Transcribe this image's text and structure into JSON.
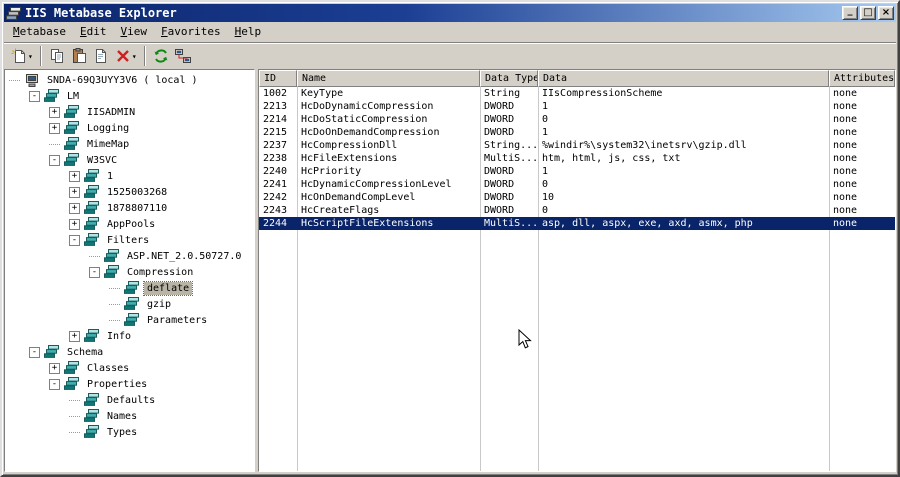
{
  "window": {
    "title": "IIS Metabase Explorer",
    "controls": {
      "minimize": "_",
      "maximize": "□",
      "close": "×"
    }
  },
  "menubar": {
    "items": [
      {
        "label": "Metabase"
      },
      {
        "label": "Edit"
      },
      {
        "label": "View"
      },
      {
        "label": "Favorites"
      },
      {
        "label": "Help"
      }
    ]
  },
  "toolbar": {
    "buttons": [
      {
        "name": "new-record-button",
        "icon": "new",
        "dropdown": true
      },
      {
        "separator": true
      },
      {
        "name": "copy-button",
        "icon": "copy"
      },
      {
        "name": "paste-button",
        "icon": "paste"
      },
      {
        "name": "edit-record-button",
        "icon": "page"
      },
      {
        "name": "delete-button",
        "icon": "delete",
        "dropdown": true
      },
      {
        "separator": true
      },
      {
        "name": "refresh-button",
        "icon": "refresh"
      },
      {
        "name": "connect-button",
        "icon": "connect"
      }
    ]
  },
  "tree": {
    "items": [
      {
        "label": "SNDA-69Q3UYY3V6 ( local )",
        "level": 0,
        "expander": "none",
        "icon": "computer"
      },
      {
        "label": "LM",
        "level": 1,
        "expander": "minus",
        "icon": "db"
      },
      {
        "label": "IISADMIN",
        "level": 2,
        "expander": "plus",
        "icon": "db"
      },
      {
        "label": "Logging",
        "level": 2,
        "expander": "plus",
        "icon": "db"
      },
      {
        "label": "MimeMap",
        "level": 2,
        "expander": "none",
        "icon": "db"
      },
      {
        "label": "W3SVC",
        "level": 2,
        "expander": "minus",
        "icon": "db"
      },
      {
        "label": "1",
        "level": 3,
        "expander": "plus",
        "icon": "db"
      },
      {
        "label": "1525003268",
        "level": 3,
        "expander": "plus",
        "icon": "db"
      },
      {
        "label": "1878807110",
        "level": 3,
        "expander": "plus",
        "icon": "db"
      },
      {
        "label": "AppPools",
        "level": 3,
        "expander": "plus",
        "icon": "db"
      },
      {
        "label": "Filters",
        "level": 3,
        "expander": "minus",
        "icon": "db"
      },
      {
        "label": "ASP.NET_2.0.50727.0",
        "level": 4,
        "expander": "none",
        "icon": "db"
      },
      {
        "label": "Compression",
        "level": 4,
        "expander": "minus",
        "icon": "db"
      },
      {
        "label": "deflate",
        "level": 5,
        "expander": "none",
        "icon": "db",
        "selected": true
      },
      {
        "label": "gzip",
        "level": 5,
        "expander": "none",
        "icon": "db"
      },
      {
        "label": "Parameters",
        "level": 5,
        "expander": "none",
        "icon": "db"
      },
      {
        "label": "Info",
        "level": 3,
        "expander": "plus",
        "icon": "db"
      },
      {
        "label": "Schema",
        "level": 1,
        "expander": "minus",
        "icon": "db"
      },
      {
        "label": "Classes",
        "level": 2,
        "expander": "plus",
        "icon": "db"
      },
      {
        "label": "Properties",
        "level": 2,
        "expander": "minus",
        "icon": "db"
      },
      {
        "label": "Defaults",
        "level": 3,
        "expander": "none",
        "icon": "db"
      },
      {
        "label": "Names",
        "level": 3,
        "expander": "none",
        "icon": "db"
      },
      {
        "label": "Types",
        "level": 3,
        "expander": "none",
        "icon": "db"
      }
    ]
  },
  "list": {
    "columns": [
      "ID",
      "Name",
      "Data Type",
      "Data",
      "Attributes"
    ],
    "rows": [
      {
        "cells": [
          "1002",
          "KeyType",
          "String",
          "IIsCompressionScheme",
          "none"
        ]
      },
      {
        "cells": [
          "2213",
          "HcDoDynamicCompression",
          "DWORD",
          "1",
          "none"
        ]
      },
      {
        "cells": [
          "2214",
          "HcDoStaticCompression",
          "DWORD",
          "0",
          "none"
        ]
      },
      {
        "cells": [
          "2215",
          "HcDoOnDemandCompression",
          "DWORD",
          "1",
          "none"
        ]
      },
      {
        "cells": [
          "2237",
          "HcCompressionDll",
          "String...",
          "%windir%\\system32\\inetsrv\\gzip.dll",
          "none"
        ]
      },
      {
        "cells": [
          "2238",
          "HcFileExtensions",
          "MultiS...",
          "htm, html, js, css, txt",
          "none"
        ]
      },
      {
        "cells": [
          "2240",
          "HcPriority",
          "DWORD",
          "1",
          "none"
        ]
      },
      {
        "cells": [
          "2241",
          "HcDynamicCompressionLevel",
          "DWORD",
          "0",
          "none"
        ]
      },
      {
        "cells": [
          "2242",
          "HcOnDemandCompLevel",
          "DWORD",
          "10",
          "none"
        ]
      },
      {
        "cells": [
          "2243",
          "HcCreateFlags",
          "DWORD",
          "0",
          "none"
        ]
      },
      {
        "cells": [
          "2244",
          "HcScriptFileExtensions",
          "MultiS...",
          "asp, dll, aspx, exe, axd, asmx, php",
          "none"
        ],
        "selected": true
      }
    ]
  },
  "colors": {
    "titlebar_left": "#0a246a",
    "titlebar_right": "#a6caf0",
    "selection": "#0a246a",
    "window_face": "#d4d0c8",
    "inactive_selection": "#b9b5a6"
  }
}
